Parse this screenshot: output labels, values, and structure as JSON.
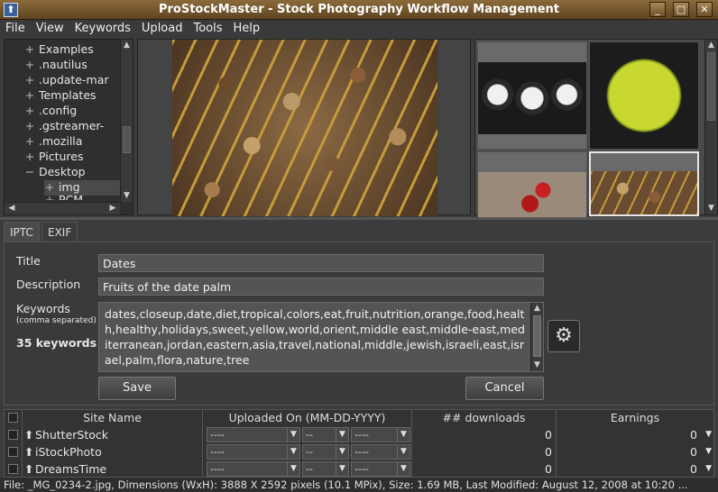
{
  "window": {
    "title": "ProStockMaster - Stock Photography Workflow Management",
    "min_icon": "minimize-icon",
    "max_icon": "maximize-icon",
    "close_icon": "close-icon"
  },
  "menu": [
    "File",
    "View",
    "Keywords",
    "Upload",
    "Tools",
    "Help"
  ],
  "tree": {
    "items": [
      {
        "label": "Examples",
        "exp": "+"
      },
      {
        "label": ".nautilus",
        "exp": "+"
      },
      {
        "label": ".update-mar",
        "exp": "+"
      },
      {
        "label": "Templates",
        "exp": "+"
      },
      {
        "label": ".config",
        "exp": "+"
      },
      {
        "label": ".gstreamer-",
        "exp": "+"
      },
      {
        "label": ".mozilla",
        "exp": "+"
      },
      {
        "label": "Pictures",
        "exp": "+"
      },
      {
        "label": "Desktop",
        "exp": "−"
      },
      {
        "label": "img",
        "exp": "+"
      },
      {
        "label": "PCM",
        "exp": "+"
      }
    ]
  },
  "tabs": [
    "IPTC",
    "EXIF"
  ],
  "iptc": {
    "title_label": "Title",
    "title_value": "Dates",
    "description_label": "Description",
    "description_value": "Fruits of the date palm",
    "keywords_label": "Keywords",
    "keywords_hint": "(comma separated)",
    "keywords_count": "35 keywords",
    "keywords_value": "dates,closeup,date,diet,tropical,colors,eat,fruit,nutrition,orange,food,health,healthy,holidays,sweet,yellow,world,orient,middle east,middle-east,mediterranean,jordan,eastern,asia,travel,national,middle,jewish,israeli,east,israel,palm,flora,nature,tree",
    "save_label": "Save",
    "cancel_label": "Cancel",
    "gear_icon": "gears-icon"
  },
  "table": {
    "headers": [
      "Site Name",
      "Uploaded On (MM-DD-YYYY)",
      "## downloads",
      "Earnings"
    ],
    "rows": [
      {
        "site": "ShutterStock",
        "month": "----",
        "day": "--",
        "year": "----",
        "downloads": "0",
        "earnings": "0"
      },
      {
        "site": "iStockPhoto",
        "month": "----",
        "day": "--",
        "year": "----",
        "downloads": "0",
        "earnings": "0"
      },
      {
        "site": "DreamsTime",
        "month": "----",
        "day": "--",
        "year": "----",
        "downloads": "0",
        "earnings": "0"
      }
    ]
  },
  "status": "File: _MG_0234-2.jpg, Dimensions (WxH): 3888 X 2592 pixels (10.1 MPix), Size: 1.69 MB, Last Modified: August 12, 2008 at 10:20 ..."
}
